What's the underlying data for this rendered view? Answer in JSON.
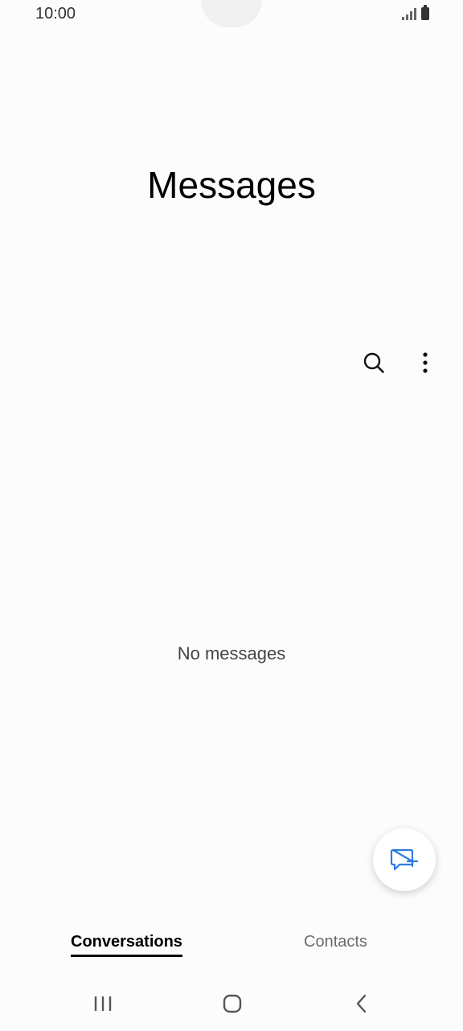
{
  "status_bar": {
    "time": "10:00",
    "icons": [
      "signal-icon",
      "battery-icon"
    ]
  },
  "header": {
    "title": "Messages"
  },
  "toolbar": {
    "icons": [
      "search-icon",
      "more-options-icon"
    ]
  },
  "main": {
    "empty_text": "No messages"
  },
  "fab": {
    "icon": "compose-message-icon",
    "accent_color": "#2c7be5"
  },
  "bottom_tabs": [
    {
      "label": "Conversations",
      "selected": true
    },
    {
      "label": "Contacts",
      "selected": false
    }
  ],
  "nav_bar": {
    "icons": [
      "recent-apps-icon",
      "home-icon",
      "back-icon"
    ]
  }
}
